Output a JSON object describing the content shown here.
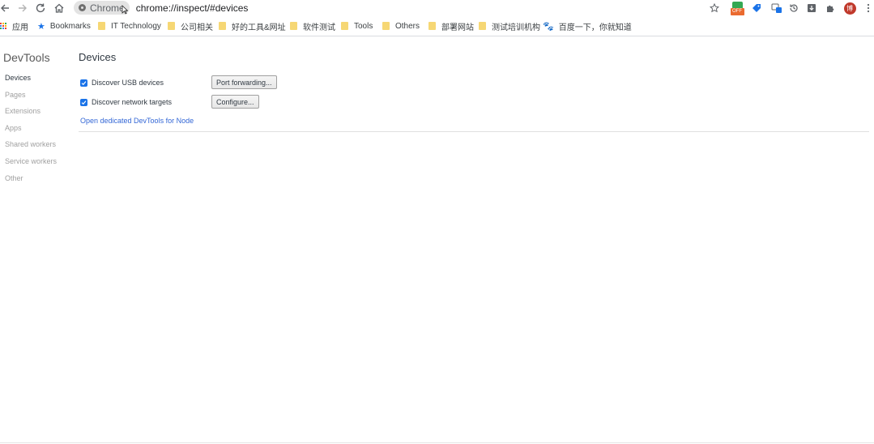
{
  "toolbar": {
    "chip_label": "Chrome",
    "url": "chrome://inspect/#devices",
    "avatar_text": "博",
    "ext_badge": "OFF"
  },
  "bookmarks": [
    {
      "label": "应用",
      "type": "apps"
    },
    {
      "label": "Bookmarks",
      "type": "star"
    },
    {
      "label": "IT Technology",
      "type": "folder"
    },
    {
      "label": "公司相关",
      "type": "folder"
    },
    {
      "label": "好的工具&网址",
      "type": "folder"
    },
    {
      "label": "软件测试",
      "type": "folder"
    },
    {
      "label": "Tools",
      "type": "folder"
    },
    {
      "label": "Others",
      "type": "folder"
    },
    {
      "label": "部署网站",
      "type": "folder"
    },
    {
      "label": "测试培训机构",
      "type": "folder"
    },
    {
      "label": "百度一下，你就知道",
      "type": "baidu"
    }
  ],
  "sidebar": {
    "title": "DevTools",
    "items": [
      {
        "label": "Devices",
        "active": true
      },
      {
        "label": "Pages",
        "active": false
      },
      {
        "label": "Extensions",
        "active": false
      },
      {
        "label": "Apps",
        "active": false
      },
      {
        "label": "Shared workers",
        "active": false
      },
      {
        "label": "Service workers",
        "active": false
      },
      {
        "label": "Other",
        "active": false
      }
    ]
  },
  "main": {
    "title": "Devices",
    "discover_usb_label": "Discover USB devices",
    "discover_usb_checked": true,
    "port_forwarding_button": "Port forwarding...",
    "discover_network_label": "Discover network targets",
    "discover_network_checked": true,
    "configure_button": "Configure...",
    "node_link": "Open dedicated DevTools for Node"
  },
  "colors": {
    "accent": "#1a73e8",
    "link": "#3367d6",
    "folder": "#f6d774",
    "avatar": "#c0392b"
  }
}
